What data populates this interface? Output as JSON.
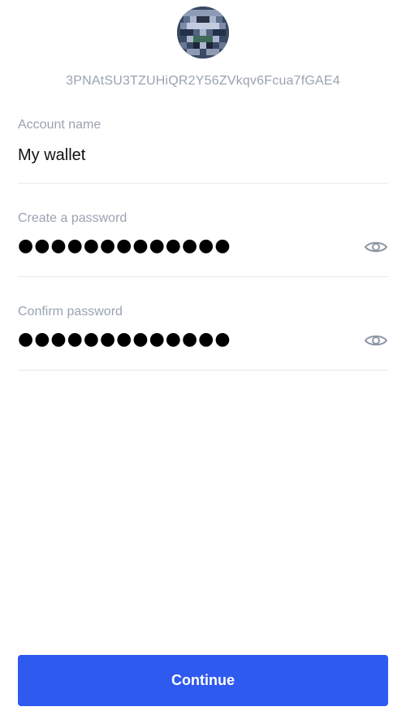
{
  "account": {
    "address": "3PNAtSU3TZUHiQR2Y56ZVkqv6Fcua7fGAE4",
    "avatar_icon": "identicon-avatar"
  },
  "form": {
    "account_name": {
      "label": "Account name",
      "value": "My wallet"
    },
    "password": {
      "label": "Create a password",
      "masked_value": "●●●●●●●●●●●●●",
      "toggle_icon": "eye-icon"
    },
    "confirm_password": {
      "label": "Confirm password",
      "masked_value": "●●●●●●●●●●●●●",
      "toggle_icon": "eye-icon"
    }
  },
  "actions": {
    "continue_label": "Continue"
  },
  "colors": {
    "primary_button": "#2f5af0",
    "label_gray": "#9aa3b0",
    "divider": "#e6e9ee"
  }
}
